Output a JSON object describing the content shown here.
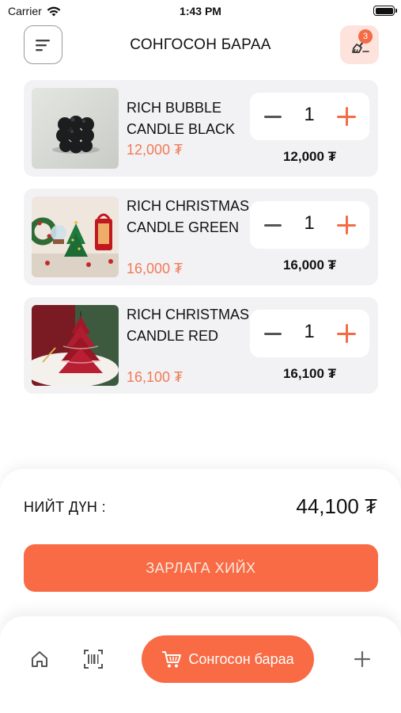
{
  "status_bar": {
    "carrier": "Carrier",
    "time": "1:43 PM"
  },
  "header": {
    "title": "СОНГОСОН БАРАА",
    "cart_badge": "3",
    "menu_icon": "menu-lines-icon",
    "clear_icon": "broom-icon"
  },
  "cart": {
    "items": [
      {
        "name": "RICH BUBBLE CANDLE BLACK",
        "unit_price": "12,000 ₮",
        "quantity": "1",
        "line_total": "12,000 ₮"
      },
      {
        "name": "RICH CHRISTMAS CANDLE GREEN",
        "unit_price": "16,000 ₮",
        "quantity": "1",
        "line_total": "16,000 ₮"
      },
      {
        "name": "RICH CHRISTMAS CANDLE RED",
        "unit_price": "16,100 ₮",
        "quantity": "1",
        "line_total": "16,100 ₮"
      }
    ]
  },
  "summary": {
    "total_label": "НИЙТ ДҮН :",
    "total_value": "44,100 ₮",
    "checkout_label": "ЗАРЛАГА ХИЙХ"
  },
  "bottom_nav": {
    "home_icon": "home-icon",
    "scan_icon": "barcode-scan-icon",
    "active_label": "Сонгосон бараа",
    "active_icon": "cart-icon",
    "add_icon": "plus-icon"
  },
  "colors": {
    "accent": "#f86b45",
    "price": "#f27a56",
    "card_bg": "#f2f2f4",
    "badge_bg": "#fde3db"
  }
}
